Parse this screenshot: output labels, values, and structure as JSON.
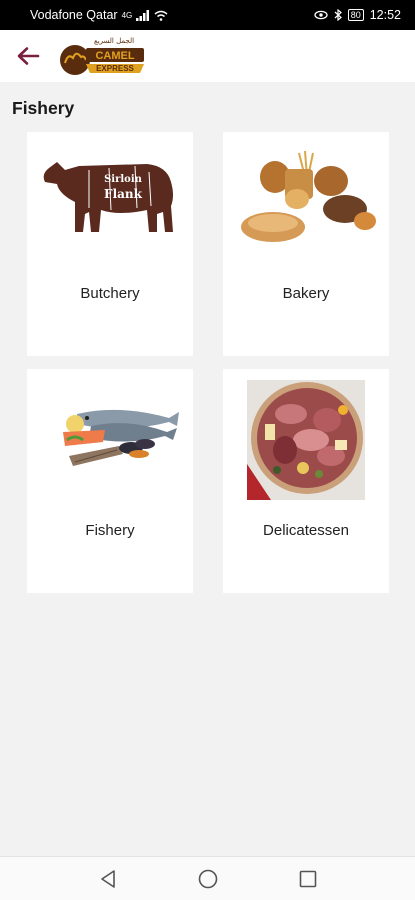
{
  "status_bar": {
    "carrier": "Vodafone Qatar",
    "network": "4G",
    "battery": "80",
    "time": "12:52"
  },
  "header": {
    "back_icon": "arrow-left-icon",
    "logo_text_top": "الجمل السريع",
    "logo_text_main": "CAMEL",
    "logo_text_sub": "EXPRESS"
  },
  "page": {
    "title": "Fishery"
  },
  "categories": [
    {
      "label": "Butchery",
      "icon": "beef-cuts-image"
    },
    {
      "label": "Bakery",
      "icon": "bread-image"
    },
    {
      "label": "Fishery",
      "icon": "fish-image"
    },
    {
      "label": "Delicatessen",
      "icon": "deli-platter-image"
    }
  ],
  "nav": {
    "back_icon": "triangle-back-icon",
    "home_icon": "circle-home-icon",
    "recents_icon": "square-recents-icon"
  },
  "colors": {
    "accent": "#7a1f3d",
    "beef": "#5a2a1f",
    "logo_dark": "#5a2c0e",
    "logo_gold": "#e0a020"
  }
}
